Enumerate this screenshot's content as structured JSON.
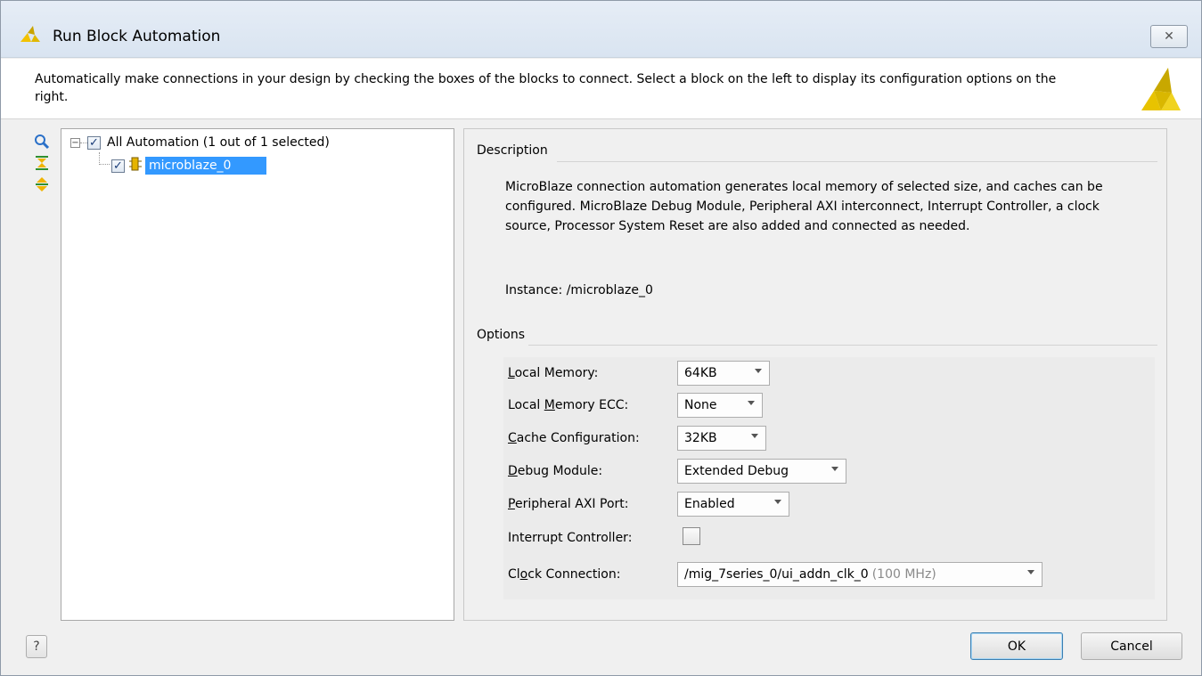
{
  "window": {
    "title": "Run Block Automation",
    "close_glyph": "✕"
  },
  "header": {
    "text": "Automatically make connections in your design by checking the boxes of the blocks to connect. Select a block on the left to display its configuration options on the right."
  },
  "tools": [
    "search-icon",
    "collapse-all-icon",
    "expand-all-icon"
  ],
  "tree": {
    "root": {
      "label": "All Automation (1 out of 1 selected)",
      "checked": true,
      "expander": "−"
    },
    "child": {
      "label": "microblaze_0",
      "checked": true,
      "selected": true,
      "icon": "ip-block-icon"
    }
  },
  "description": {
    "title": "Description",
    "text": "MicroBlaze connection automation generates local memory of selected size, and caches can be configured. MicroBlaze Debug Module, Peripheral AXI interconnect, Interrupt Controller, a clock source, Processor System Reset are also added and connected as needed.",
    "instance": "Instance: /microblaze_0"
  },
  "options": {
    "title": "Options",
    "local_memory": {
      "label_u": "L",
      "label_rest": "ocal Memory:",
      "value": "64KB"
    },
    "local_memory_ecc": {
      "label_pre": "Local ",
      "label_u": "M",
      "label_rest": "emory ECC:",
      "value": "None"
    },
    "cache_configuration": {
      "label_u": "C",
      "label_rest": "ache Configuration:",
      "value": "32KB"
    },
    "debug_module": {
      "label_u": "D",
      "label_rest": "ebug Module:",
      "value": "Extended Debug"
    },
    "peripheral_axi_port": {
      "label_u": "P",
      "label_rest": "eripheral AXI Port:",
      "value": "Enabled"
    },
    "interrupt_controller": {
      "label": "Interrupt Controller:",
      "checked": false
    },
    "clock_connection": {
      "label_pre": "Cl",
      "label_u": "o",
      "label_rest": "ck Connection:",
      "value": "/mig_7series_0/ui_addn_clk_0",
      "value_note": "(100 MHz)"
    }
  },
  "footer": {
    "help_label": "?",
    "ok_label": "OK",
    "cancel_label": "Cancel"
  },
  "colors": {
    "selection": "#3399ff",
    "accent_logo": "#f2c200"
  }
}
